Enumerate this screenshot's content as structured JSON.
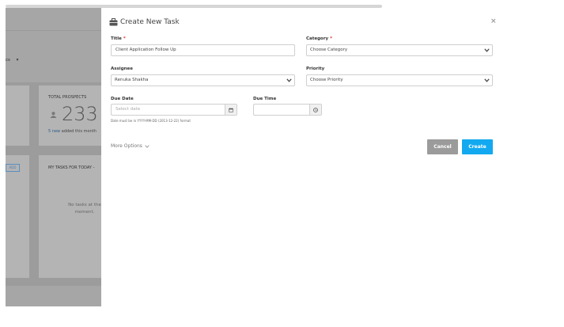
{
  "background": {
    "dropdown_label": "cs",
    "dropdown_caret": "▾",
    "prospects_card": {
      "title": "TOTAL PROSPECTS",
      "value": "233",
      "icon": "person-icon",
      "new_count_text": "5 new",
      "new_suffix": " added this month"
    },
    "tasks_card": {
      "title": "MY TASKS FOR TODAY -",
      "add_label": "ADD",
      "empty_text": "No tasks at the moment."
    }
  },
  "modal": {
    "title": "Create New Task",
    "title_icon": "briefcase-icon",
    "close_label": "×",
    "fields": {
      "title": {
        "label": "Title",
        "required": "*",
        "value": "Client Application Follow Up"
      },
      "category": {
        "label": "Category",
        "required": "*",
        "value": "Choose Category"
      },
      "assignee": {
        "label": "Assignee",
        "value": "Renuka Shakha"
      },
      "priority": {
        "label": "Priority",
        "value": "Choose Priority"
      },
      "due_date": {
        "label": "Due Date",
        "placeholder": "Select date",
        "hint": "Date must be in YYYY-MM-DD (2013-12-22) format"
      },
      "due_time": {
        "label": "Due Time",
        "value": ""
      }
    },
    "more_options_label": "More Options",
    "cancel_label": "Cancel",
    "create_label": "Create"
  },
  "colors": {
    "create_button": "#13a9f0",
    "cancel_button": "#9b9b9b",
    "required_mark": "#e03030",
    "overlay": "#a6a6a6"
  }
}
